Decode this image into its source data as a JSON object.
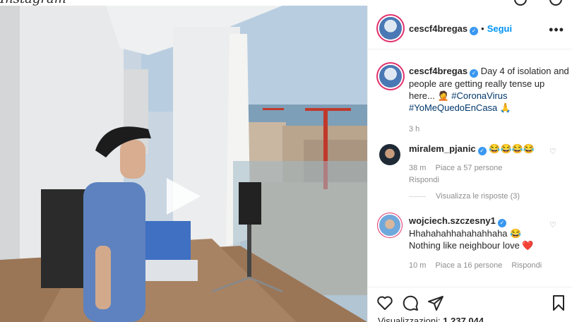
{
  "app": {
    "logo_text": "Instagram"
  },
  "post": {
    "username": "cescf4bregas",
    "follow_label": "Segui",
    "caption_text": "Day 4 of isolation and people are getting really tense up here... 🤦",
    "hashtags": [
      "#CoronaVirus",
      "#YoMeQuedoEnCasa"
    ],
    "hashtag_suffix": "🙏",
    "time_ago": "3 h",
    "views_label": "Visualizzazioni:",
    "views_count": "1.237.044"
  },
  "comments": [
    {
      "username": "miralem_pjanic",
      "text": "😂😂😂😂",
      "time": "38 m",
      "likes": "Piace a 57 persone",
      "reply_label": "Rispondi",
      "view_replies": "Visualizza le risposte (3)"
    },
    {
      "username": "wojciech.szczesny1",
      "text_line1": "Hhahahahhahahahhaha 😂",
      "text_line2": "Nothing like neighbour love ❤️",
      "time": "10 m",
      "likes": "Piace a 16 persone",
      "reply_label": "Rispondi"
    }
  ],
  "icons": [
    "play-icon",
    "more-options-icon",
    "heart-icon",
    "comment-icon",
    "share-icon",
    "bookmark-icon",
    "verified-icon"
  ],
  "colors": {
    "follow": "#0095f6",
    "hashtag": "#00376b",
    "verified": "#3897f0",
    "text": "#262626",
    "muted": "#8e8e8e"
  }
}
